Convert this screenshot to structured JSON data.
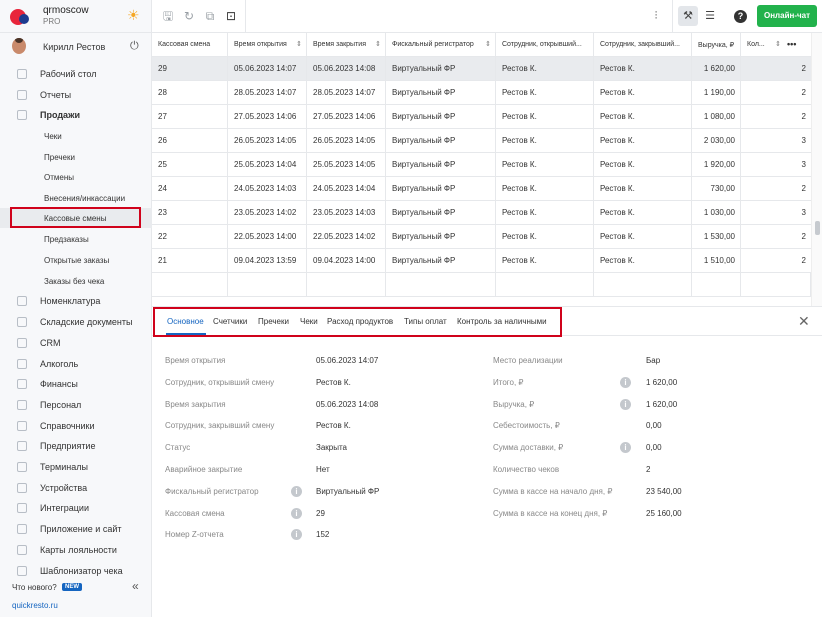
{
  "brand": {
    "name": "qrmoscow",
    "plan": "PRO"
  },
  "user": {
    "name": "Кирилл Рестов"
  },
  "nav": [
    {
      "label": "Рабочий стол",
      "icon": "speedometer-icon"
    },
    {
      "label": "Отчеты",
      "icon": "chart-icon"
    },
    {
      "label": "Продажи",
      "icon": "basket-icon"
    },
    {
      "label": "Номенклатура",
      "icon": "tag-icon"
    },
    {
      "label": "Складские документы",
      "icon": "box-icon"
    },
    {
      "label": "CRM",
      "icon": "crm-icon"
    },
    {
      "label": "Алкоголь",
      "icon": "glass-icon"
    },
    {
      "label": "Финансы",
      "icon": "wallet-icon"
    },
    {
      "label": "Персонал",
      "icon": "people-icon"
    },
    {
      "label": "Справочники",
      "icon": "book-icon"
    },
    {
      "label": "Предприятие",
      "icon": "building-icon"
    },
    {
      "label": "Терминалы",
      "icon": "terminal-icon"
    },
    {
      "label": "Устройства",
      "icon": "printer-icon"
    },
    {
      "label": "Интеграции",
      "icon": "link-icon"
    },
    {
      "label": "Приложение и сайт",
      "icon": "phone-icon"
    },
    {
      "label": "Карты лояльности",
      "icon": "card-icon"
    },
    {
      "label": "Шаблонизатор чека",
      "icon": "receipt-icon"
    }
  ],
  "sales_sub": [
    "Чеки",
    "Пречеки",
    "Отмены",
    "Внесения/инкассации",
    "Кассовые смены",
    "Предзаказы",
    "Открытые заказы",
    "Заказы без чека"
  ],
  "footer": {
    "whats_new": "Что нового?",
    "new_badge": "NEW",
    "site": "quickresto.ru"
  },
  "toolbar": {
    "chat_button": "Онлайн-чат",
    "help": "?"
  },
  "table": {
    "headers": [
      "Кассовая смена",
      "Время открытия",
      "Время закрытия",
      "Фискальный регистратор",
      "Сотрудник, открывший...",
      "Сотрудник, закрывший...",
      "Выручка, ₽",
      "Кол..."
    ],
    "rows": [
      [
        "29",
        "05.06.2023 14:07",
        "05.06.2023 14:08",
        "Виртуальный ФР",
        "Рестов К.",
        "Рестов К.",
        "1 620,00",
        "2"
      ],
      [
        "28",
        "28.05.2023 14:07",
        "28.05.2023 14:07",
        "Виртуальный ФР",
        "Рестов К.",
        "Рестов К.",
        "1 190,00",
        "2"
      ],
      [
        "27",
        "27.05.2023 14:06",
        "27.05.2023 14:06",
        "Виртуальный ФР",
        "Рестов К.",
        "Рестов К.",
        "1 080,00",
        "2"
      ],
      [
        "26",
        "26.05.2023 14:05",
        "26.05.2023 14:05",
        "Виртуальный ФР",
        "Рестов К.",
        "Рестов К.",
        "2 030,00",
        "3"
      ],
      [
        "25",
        "25.05.2023 14:04",
        "25.05.2023 14:05",
        "Виртуальный ФР",
        "Рестов К.",
        "Рестов К.",
        "1 920,00",
        "3"
      ],
      [
        "24",
        "24.05.2023 14:03",
        "24.05.2023 14:04",
        "Виртуальный ФР",
        "Рестов К.",
        "Рестов К.",
        "730,00",
        "2"
      ],
      [
        "23",
        "23.05.2023 14:02",
        "23.05.2023 14:03",
        "Виртуальный ФР",
        "Рестов К.",
        "Рестов К.",
        "1 030,00",
        "3"
      ],
      [
        "22",
        "22.05.2023 14:00",
        "22.05.2023 14:02",
        "Виртуальный ФР",
        "Рестов К.",
        "Рестов К.",
        "1 530,00",
        "2"
      ],
      [
        "21",
        "09.04.2023 13:59",
        "09.04.2023 14:00",
        "Виртуальный ФР",
        "Рестов К.",
        "Рестов К.",
        "1 510,00",
        "2"
      ]
    ]
  },
  "tabs": [
    "Основное",
    "Счетчики",
    "Пречеки",
    "Чеки",
    "Расход продуктов",
    "Типы оплат",
    "Контроль за наличными"
  ],
  "details_left": [
    {
      "label": "Время открытия",
      "value": "05.06.2023 14:07",
      "info": false
    },
    {
      "label": "Сотрудник, открывший смену",
      "value": "Рестов К.",
      "info": false
    },
    {
      "label": "Время закрытия",
      "value": "05.06.2023 14:08",
      "info": false
    },
    {
      "label": "Сотрудник, закрывший смену",
      "value": "Рестов К.",
      "info": false
    },
    {
      "label": "Статус",
      "value": "Закрыта",
      "info": false
    },
    {
      "label": "Аварийное закрытие",
      "value": "Нет",
      "info": false
    },
    {
      "label": "Фискальный регистратор",
      "value": "Виртуальный ФР",
      "info": true
    },
    {
      "label": "Кассовая смена",
      "value": "29",
      "info": true
    },
    {
      "label": "Номер Z-отчета",
      "value": "152",
      "info": true
    }
  ],
  "details_right": [
    {
      "label": "Место реализации",
      "value": "Бар",
      "info": false
    },
    {
      "label": "Итого, ₽",
      "value": "1 620,00",
      "info": true
    },
    {
      "label": "Выручка, ₽",
      "value": "1 620,00",
      "info": true
    },
    {
      "label": "Себестоимость, ₽",
      "value": "0,00",
      "info": false
    },
    {
      "label": "Сумма доставки, ₽",
      "value": "0,00",
      "info": true
    },
    {
      "label": "Количество чеков",
      "value": "2",
      "info": false
    },
    {
      "label": "Сумма в кассе на начало дня, ₽",
      "value": "23 540,00",
      "info": false
    },
    {
      "label": "Сумма в кассе на конец дня, ₽",
      "value": "25 160,00",
      "info": false
    }
  ]
}
